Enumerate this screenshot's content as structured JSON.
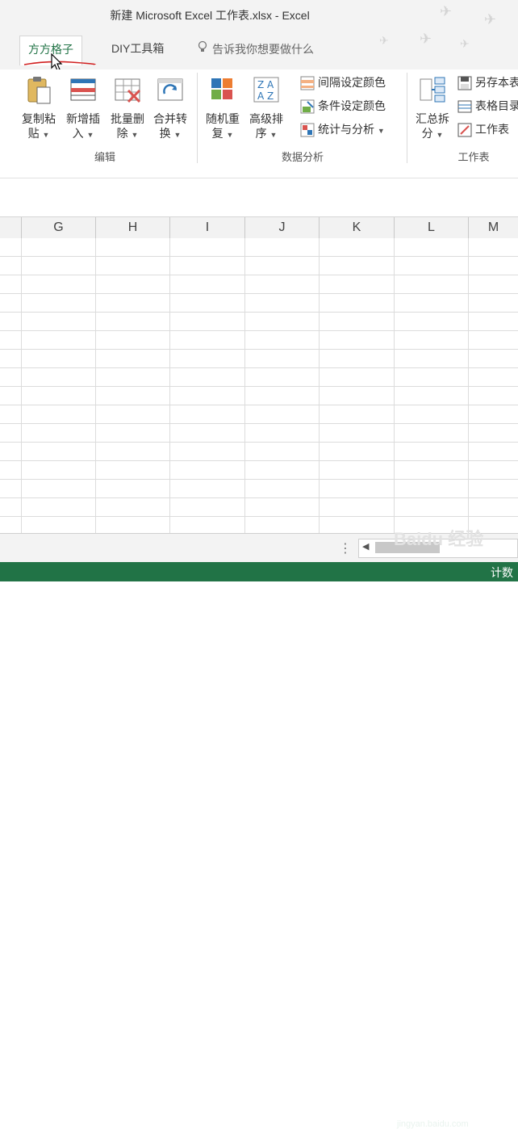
{
  "window": {
    "title": "新建 Microsoft Excel 工作表.xlsx - Excel"
  },
  "tabs": [
    {
      "label": "方方格子",
      "active": true
    },
    {
      "label": "DIY工具箱",
      "active": false
    }
  ],
  "tell_me": {
    "placeholder": "告诉我你想要做什么"
  },
  "ribbon": {
    "groups": [
      {
        "label": "编辑"
      },
      {
        "label": "数据分析"
      },
      {
        "label": "工作表"
      }
    ],
    "edit": {
      "copy_paste": {
        "line1": "复制粘",
        "line2": "贴"
      },
      "insert": {
        "line1": "新增插",
        "line2": "入"
      },
      "batch_delete": {
        "line1": "批量删",
        "line2": "除"
      },
      "merge_convert": {
        "line1": "合并转",
        "line2": "换"
      }
    },
    "analysis": {
      "random_repeat": {
        "line1": "随机重",
        "line2": "复"
      },
      "advanced_sort": {
        "line1": "高级排",
        "line2": "序"
      },
      "interval_color": "间隔设定颜色",
      "condition_color": "条件设定颜色",
      "stats": "统计与分析"
    },
    "sheet": {
      "summary_split": {
        "line1": "汇总拆",
        "line2": "分"
      },
      "save_as": "另存本表",
      "table_dir": "表格目录",
      "worksheet": "工作表"
    }
  },
  "columns": [
    "G",
    "H",
    "I",
    "J",
    "K",
    "L",
    "M"
  ],
  "status": {
    "text": "计数"
  },
  "watermark": {
    "brand": "Baidu 经验",
    "url": "jingyan.baidu.com"
  },
  "colors": {
    "accent": "#217346",
    "annotation": "#d11f1f"
  }
}
